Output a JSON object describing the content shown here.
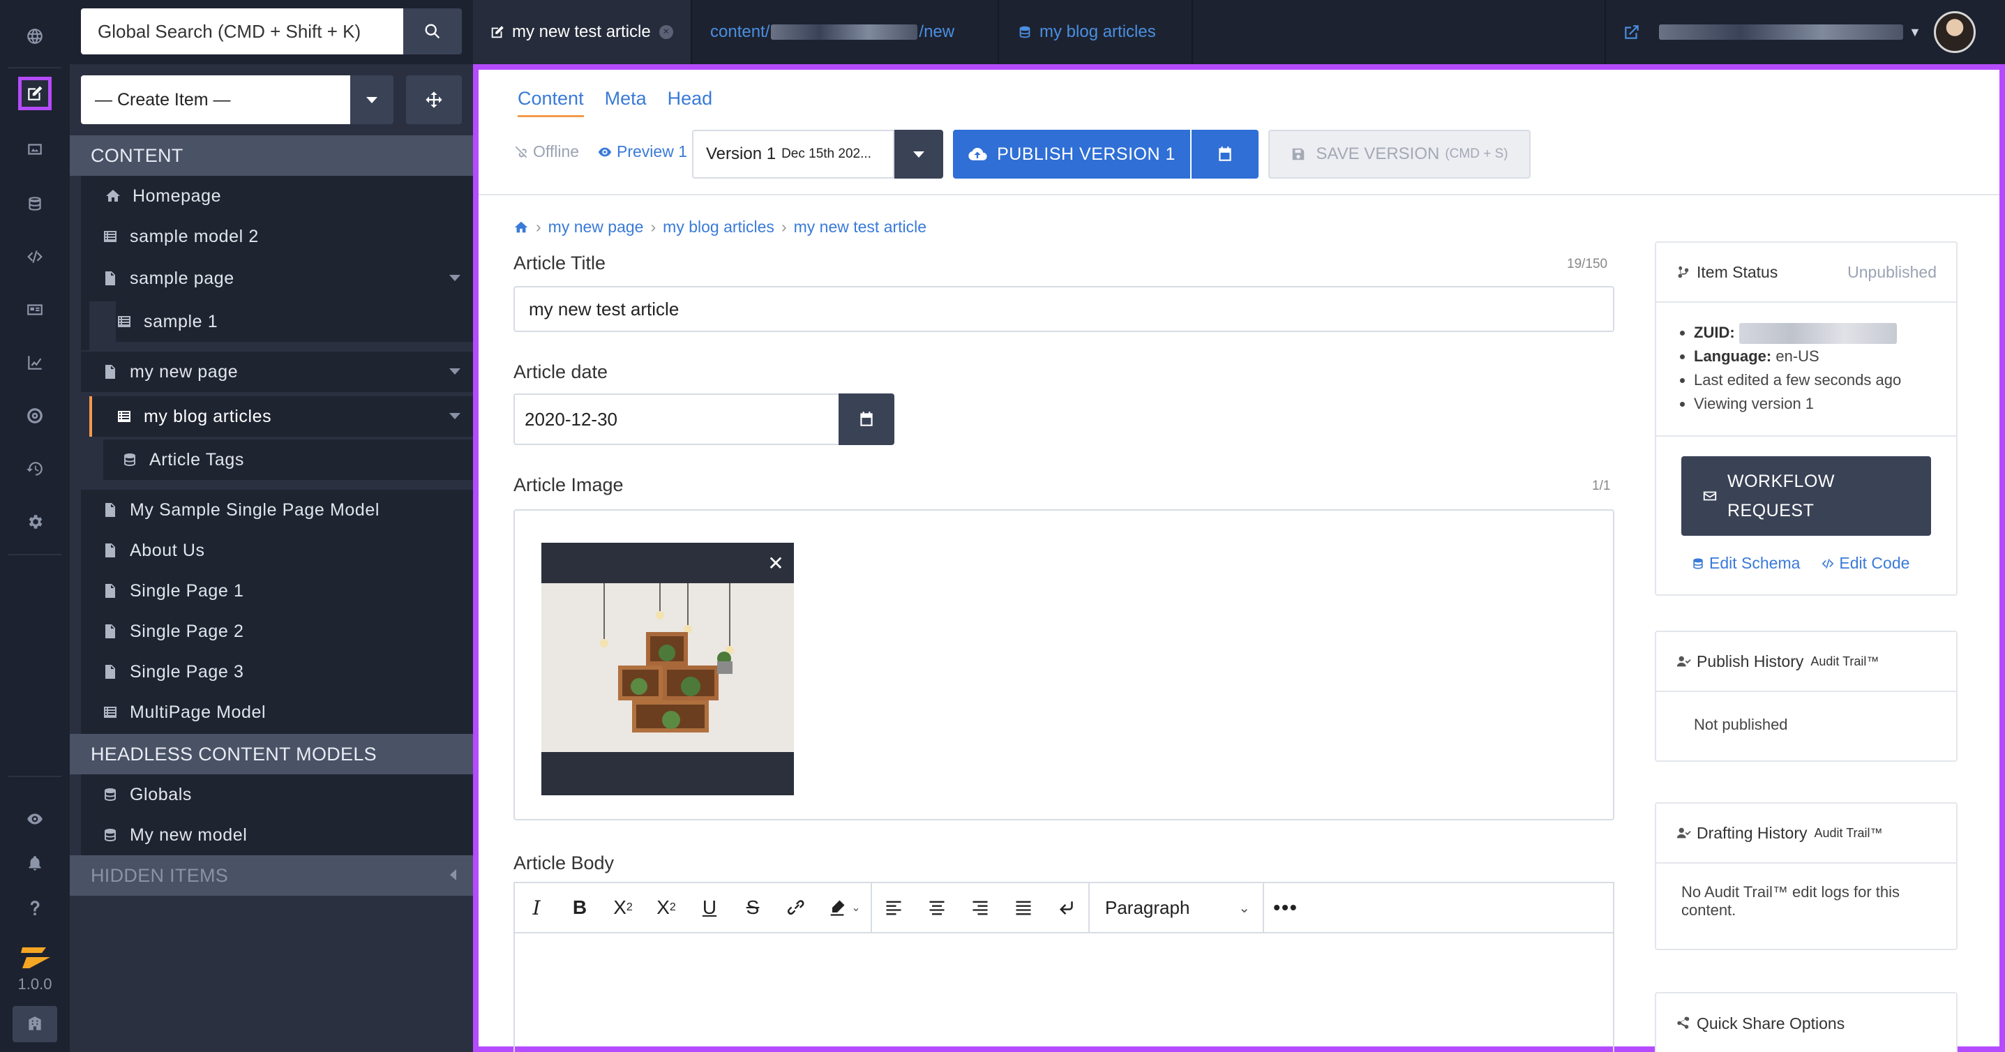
{
  "rail": {
    "version": "1.0.0"
  },
  "topbar": {
    "search_placeholder": "Global Search (CMD + Shift + K)",
    "tabs": [
      {
        "label": "my new test article"
      },
      {
        "label_prefix": "content/",
        "label_suffix": "/new"
      },
      {
        "label": "my blog articles"
      }
    ]
  },
  "sidebar": {
    "create_item": "— Create Item —",
    "content_header": "CONTENT",
    "items": {
      "homepage": "Homepage",
      "sample_model_2": "sample model 2",
      "sample_page": "sample page",
      "sample_1": "sample 1",
      "my_new_page": "my new page",
      "my_blog_articles": "my blog articles",
      "article_tags": "Article Tags",
      "my_sample_single_page_model": "My Sample Single Page Model",
      "about_us": "About Us",
      "single_page_1": "Single Page 1",
      "single_page_2": "Single Page 2",
      "single_page_3": "Single Page 3",
      "multipage_model": "MultiPage Model"
    },
    "headless_header": "HEADLESS CONTENT MODELS",
    "headless_items": {
      "globals": "Globals",
      "my_new_model": "My new model"
    },
    "hidden_header": "HIDDEN ITEMS"
  },
  "main": {
    "subtabs": [
      "Content",
      "Meta",
      "Head"
    ],
    "offline": "Offline",
    "preview": "Preview 1",
    "version": {
      "label": "Version 1",
      "date": "Dec 15th 202..."
    },
    "publish": "PUBLISH VERSION 1",
    "save": {
      "label": "SAVE VERSION",
      "shortcut": "(CMD + S)"
    },
    "breadcrumb": [
      "my new page",
      "my blog articles",
      "my new test article"
    ],
    "fields": {
      "title": {
        "label": "Article Title",
        "counter": "19/150",
        "value": "my new test article"
      },
      "date": {
        "label": "Article date",
        "value": "2020-12-30"
      },
      "image": {
        "label": "Article Image",
        "counter": "1/1"
      },
      "body": {
        "label": "Article Body",
        "format": "Paragraph"
      }
    }
  },
  "status_card": {
    "title": "Item Status",
    "state": "Unpublished",
    "zuid_label": "ZUID:",
    "language_label": "Language:",
    "language": "en-US",
    "last_edited": "Last edited a few seconds ago",
    "viewing": "Viewing version 1",
    "workflow_line1": "WORKFLOW",
    "workflow_line2": "REQUEST",
    "edit_schema": "Edit Schema",
    "edit_code": "Edit Code"
  },
  "publish_history": {
    "title": "Publish History",
    "badge": "Audit Trail™",
    "body": "Not published"
  },
  "drafting_history": {
    "title": "Drafting History",
    "badge": "Audit Trail™",
    "body": "No Audit Trail™ edit logs for this content."
  },
  "quick_share": {
    "title": "Quick Share Options"
  },
  "colors": {
    "accent": "#2f6fd6",
    "highlight": "#b54bff",
    "sidebar": "#2a3040",
    "rail": "#1d2230"
  }
}
